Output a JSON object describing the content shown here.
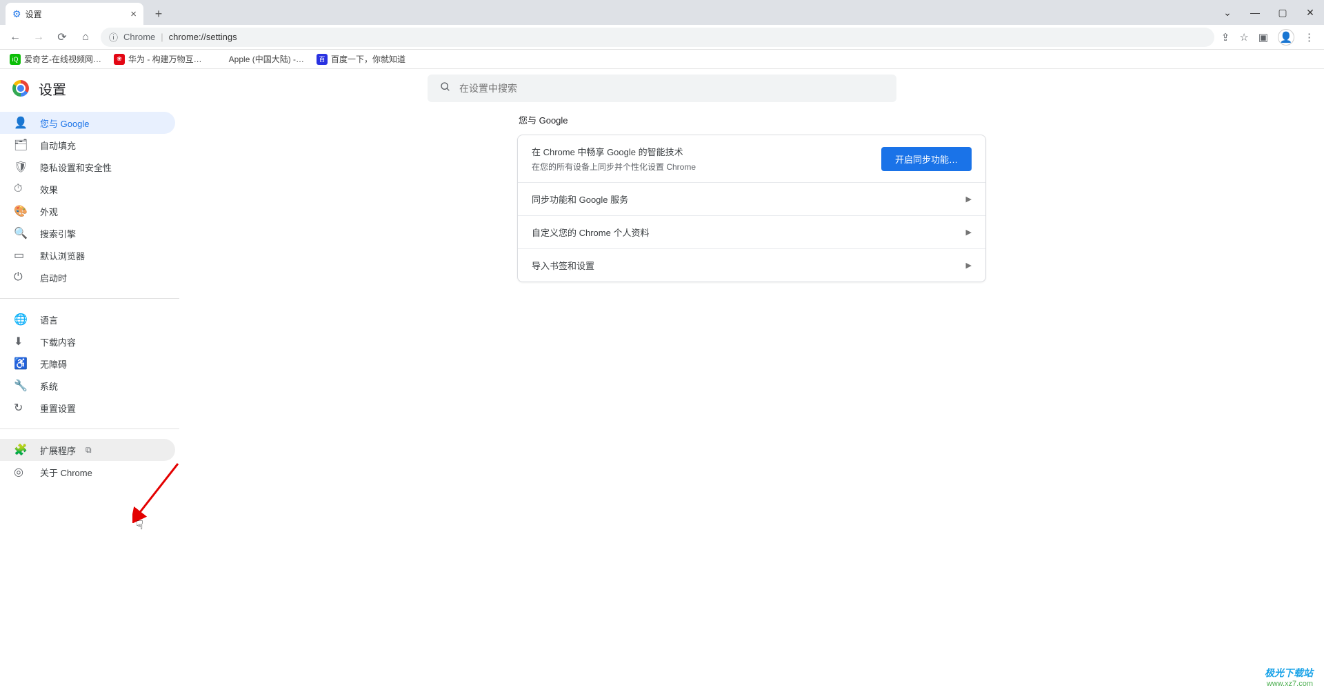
{
  "browser": {
    "tab_title": "设置",
    "url_prefix": "Chrome",
    "url_main": "chrome://settings",
    "bookmarks": [
      {
        "label": "爱奇艺-在线视频网…",
        "favicon": "iqiyi"
      },
      {
        "label": "华为 - 构建万物互…",
        "favicon": "huawei"
      },
      {
        "label": "Apple (中国大陆) -…",
        "favicon": "apple"
      },
      {
        "label": "百度一下，你就知道",
        "favicon": "baidu"
      }
    ]
  },
  "page": {
    "title": "设置",
    "search_placeholder": "在设置中搜索"
  },
  "sidebar": {
    "group1": [
      {
        "icon": "person",
        "label": "您与 Google"
      },
      {
        "icon": "autofill",
        "label": "自动填充"
      },
      {
        "icon": "privacy",
        "label": "隐私设置和安全性"
      },
      {
        "icon": "performance",
        "label": "效果"
      },
      {
        "icon": "appearance",
        "label": "外观"
      },
      {
        "icon": "search",
        "label": "搜索引擎"
      },
      {
        "icon": "default",
        "label": "默认浏览器"
      },
      {
        "icon": "startup",
        "label": "启动时"
      }
    ],
    "group2": [
      {
        "icon": "language",
        "label": "语言"
      },
      {
        "icon": "downloads",
        "label": "下载内容"
      },
      {
        "icon": "accessibility",
        "label": "无障碍"
      },
      {
        "icon": "system",
        "label": "系统"
      },
      {
        "icon": "reset",
        "label": "重置设置"
      }
    ],
    "group3": [
      {
        "icon": "extension",
        "label": "扩展程序",
        "opens_external": true
      },
      {
        "icon": "about",
        "label": "关于 Chrome"
      }
    ]
  },
  "main": {
    "section_title": "您与 Google",
    "sync_card": {
      "title": "在 Chrome 中畅享 Google 的智能技术",
      "subtitle": "在您的所有设备上同步并个性化设置 Chrome",
      "button": "开启同步功能…"
    },
    "rows": [
      "同步功能和 Google 服务",
      "自定义您的 Chrome 个人资料",
      "导入书签和设置"
    ]
  },
  "watermark": {
    "name": "极光下载站",
    "url": "www.xz7.com"
  }
}
